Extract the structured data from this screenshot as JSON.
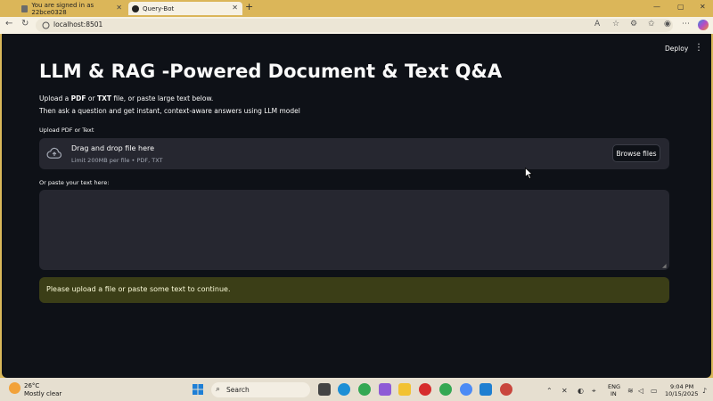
{
  "browser": {
    "tabs": [
      {
        "title": "You are signed in as 22bce0328",
        "active": false
      },
      {
        "title": "Query-Bot",
        "active": true
      }
    ],
    "new_tab": "+",
    "url": "localhost:8501",
    "window_controls": {
      "minimize": "—",
      "maximize": "▢",
      "close": "✕"
    }
  },
  "app": {
    "deploy_label": "Deploy",
    "menu_glyph": "⋮",
    "title": "LLM & RAG -Powered Document & Text Q&A",
    "desc_line1": {
      "pre": "Upload a ",
      "b1": "PDF",
      "mid": " or ",
      "b2": "TXT",
      "post": " file, or paste large text below."
    },
    "desc_line2": "Then ask a question and get instant, context-aware answers using LLM model",
    "upload_label": "Upload PDF or Text",
    "dropzone_title": "Drag and drop file here",
    "dropzone_sub": "Limit 200MB per file • PDF, TXT",
    "browse_label": "Browse files",
    "paste_label": "Or paste your text here:",
    "textarea_value": "",
    "info_message": "Please upload a file or paste some text to continue."
  },
  "taskbar": {
    "weather_temp": "26°C",
    "weather_desc": "Mostly clear",
    "search_label": "Search",
    "lang1": "ENG",
    "lang2": "IN",
    "time": "9:04 PM",
    "date": "10/15/2025"
  },
  "colors": {
    "page_bg": "#0e1117",
    "widget_bg": "#262730",
    "info_bg": "#3b3e17",
    "tabstrip": "#dbb659"
  }
}
